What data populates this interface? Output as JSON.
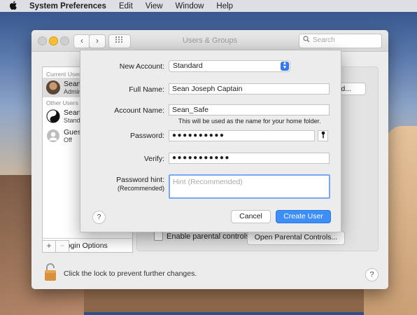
{
  "menubar": {
    "apple_icon": "apple-icon",
    "app_name": "System Preferences",
    "items": [
      "Edit",
      "View",
      "Window",
      "Help"
    ]
  },
  "window": {
    "title": "Users & Groups",
    "search_placeholder": "Search",
    "search_icon": "magnifier-icon",
    "grid_icon": "grid-icon",
    "nav_back": "‹",
    "nav_forward": "›"
  },
  "sidebar": {
    "current_user_header": "Current User",
    "current_user": {
      "name": "Sean",
      "role": "Admin"
    },
    "other_users_header": "Other Users",
    "other_users": [
      {
        "name": "Sean",
        "role": "Standard"
      },
      {
        "name": "Guest User",
        "role": "Off"
      }
    ],
    "login_options": "Login Options",
    "add_button": "+",
    "remove_button": "−"
  },
  "right_pane": {
    "password_button": "ord...",
    "parental_checkbox_label": "Enable parental controls",
    "parental_checked": false,
    "open_parental_button": "Open Parental Controls..."
  },
  "footer": {
    "lock_text": "Click the lock to prevent further changes.",
    "help": "?"
  },
  "sheet": {
    "new_account_label": "New Account:",
    "new_account_value": "Standard",
    "full_name_label": "Full Name:",
    "full_name_value": "Sean Joseph Captain",
    "account_name_label": "Account Name:",
    "account_name_value": "Sean_Safe",
    "account_name_note": "This will be used as the name for your home folder.",
    "password_label": "Password:",
    "password_value": "●●●●●●●●●●",
    "verify_label": "Verify:",
    "verify_value": "●●●●●●●●●●●",
    "hint_label": "Password hint:",
    "hint_sublabel": "(Recommended)",
    "hint_placeholder": "Hint (Recommended)",
    "help": "?",
    "cancel_button": "Cancel",
    "create_button": "Create User"
  }
}
